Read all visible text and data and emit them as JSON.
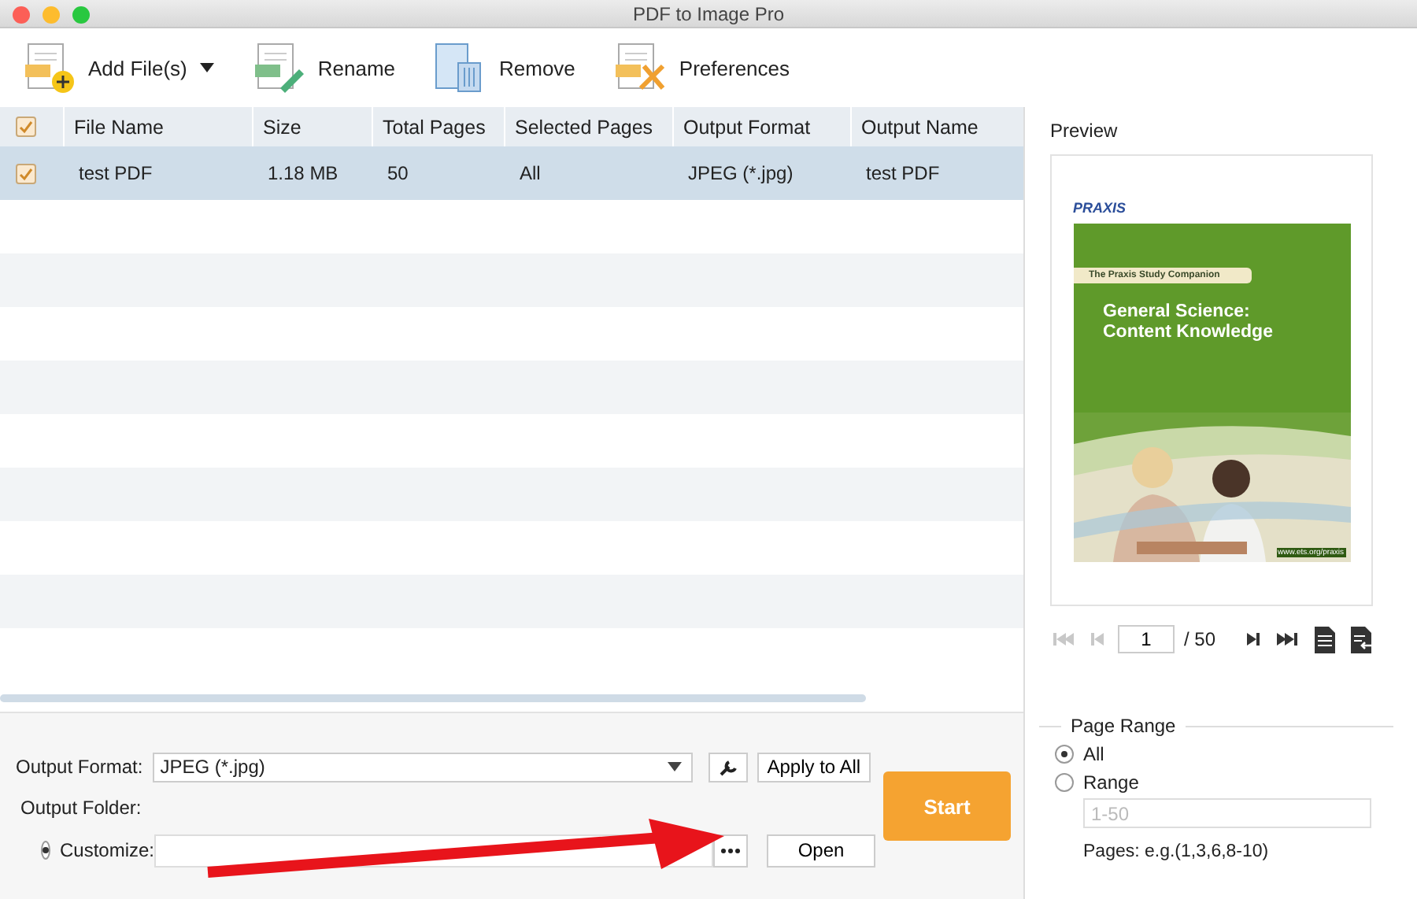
{
  "window": {
    "title": "PDF to Image Pro"
  },
  "toolbar": [
    {
      "kind": "add",
      "label": "Add File(s)",
      "dropdown": true
    },
    {
      "kind": "rename",
      "label": "Rename",
      "dropdown": false
    },
    {
      "kind": "remove",
      "label": "Remove",
      "dropdown": false
    },
    {
      "kind": "preferences",
      "label": "Preferences",
      "dropdown": false
    }
  ],
  "table": {
    "all_checked": true,
    "columns": [
      "File Name",
      "Size",
      "Total Pages",
      "Selected Pages",
      "Output Format",
      "Output Name"
    ],
    "rows": [
      {
        "checked": true,
        "selected": true,
        "cells": [
          "test PDF",
          "1.18 MB",
          "50",
          "All",
          "JPEG (*.jpg)",
          "test PDF"
        ]
      }
    ]
  },
  "output": {
    "format_label": "Output Format:",
    "format_value": "JPEG (*.jpg)",
    "apply_label": "Apply to All",
    "folder_label": "Output Folder:",
    "customize_label": "Customize:",
    "customize_selected": true,
    "open_label": "Open",
    "start_label": "Start"
  },
  "preview": {
    "title": "Preview",
    "document": {
      "brand": "PRAXIS",
      "series": "The Praxis Study Companion",
      "title_lines": [
        "General Science:",
        "Content Knowledge"
      ],
      "url": "www.ets.org/praxis"
    },
    "nav": [
      {
        "kind": "first",
        "disabled": true
      },
      {
        "kind": "prev",
        "disabled": true
      }
    ],
    "page": "1",
    "total": "/ 50",
    "nav_after": [
      {
        "kind": "next",
        "disabled": false
      },
      {
        "kind": "last",
        "disabled": false
      },
      {
        "kind": "page",
        "disabled": false
      },
      {
        "kind": "page-export",
        "disabled": false
      }
    ]
  },
  "page_range": {
    "title": "Page Range",
    "options": [
      {
        "label": "All",
        "selected": true
      },
      {
        "label": "Range",
        "selected": false
      }
    ],
    "range_placeholder": "1-50",
    "hint": "Pages: e.g.(1,3,6,8-10)"
  }
}
